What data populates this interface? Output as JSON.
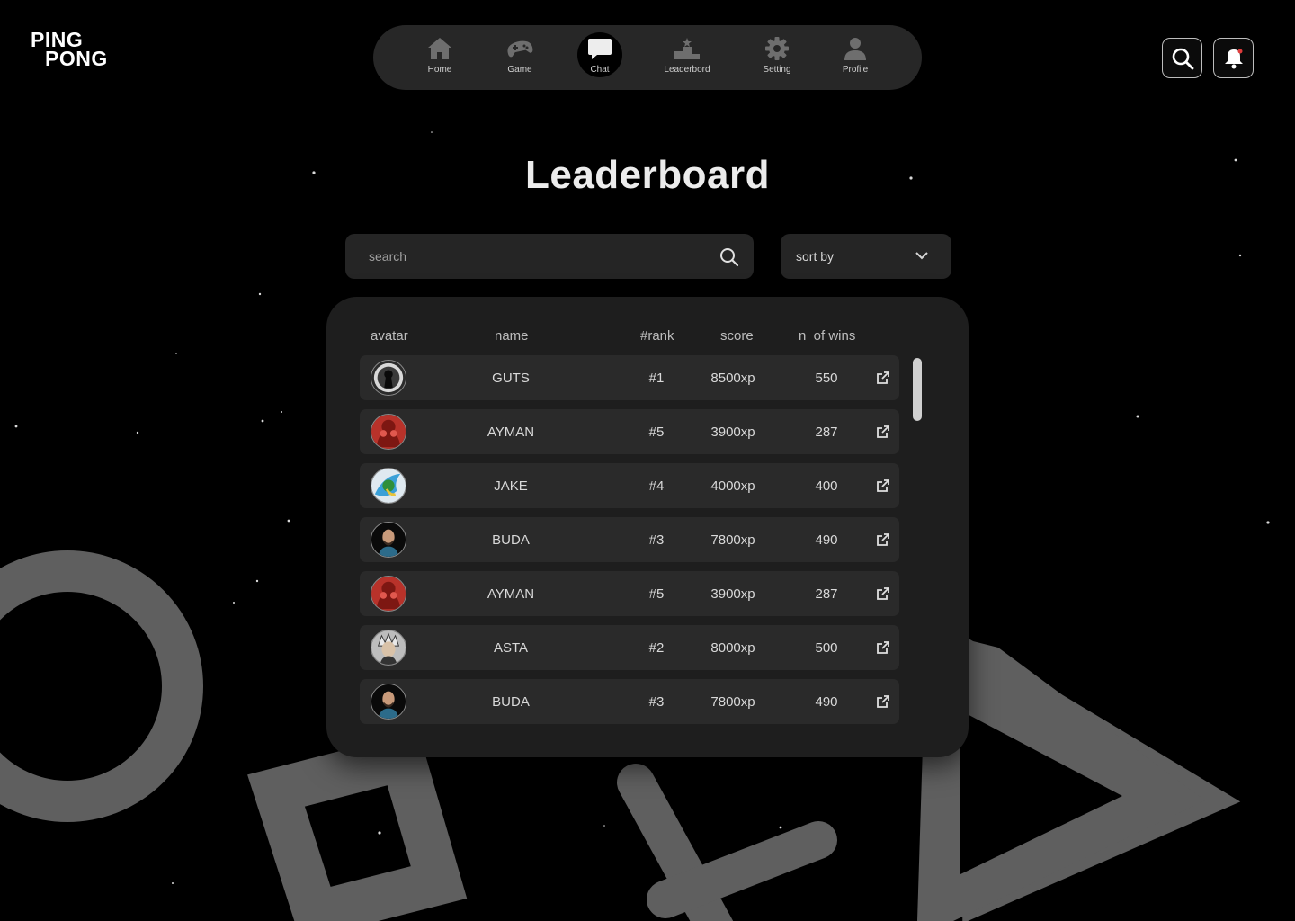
{
  "logo": {
    "line1": "PING",
    "line2": "PONG"
  },
  "nav": {
    "items": [
      {
        "label": "Home",
        "icon": "home-icon"
      },
      {
        "label": "Game",
        "icon": "gamepad-icon"
      },
      {
        "label": "Chat",
        "icon": "chat-icon",
        "active": true
      },
      {
        "label": "Leaderbord",
        "icon": "podium-icon"
      },
      {
        "label": "Setting",
        "icon": "gear-icon"
      },
      {
        "label": "Profile",
        "icon": "user-icon"
      }
    ]
  },
  "header": {
    "search_icon": "search-icon",
    "notification_icon": "bell-icon"
  },
  "page": {
    "title": "Leaderboard"
  },
  "controls": {
    "search_placeholder": "search",
    "sort_label": "sort by"
  },
  "table": {
    "headers": {
      "avatar": "avatar",
      "name": "name",
      "rank": "#rank",
      "score": "score",
      "wins": "n  of wins"
    },
    "rows": [
      {
        "name": "GUTS",
        "rank": "#1",
        "score": "8500xp",
        "wins": "550",
        "avatar": "keyhole"
      },
      {
        "name": "AYMAN",
        "rank": "#5",
        "score": "3900xp",
        "wins": "287",
        "avatar": "red"
      },
      {
        "name": "JAKE",
        "rank": "#4",
        "score": "4000xp",
        "wins": "400",
        "avatar": "bird"
      },
      {
        "name": "BUDA",
        "rank": "#3",
        "score": "7800xp",
        "wins": "490",
        "avatar": "man"
      },
      {
        "name": "AYMAN",
        "rank": "#5",
        "score": "3900xp",
        "wins": "287",
        "avatar": "red"
      },
      {
        "name": "ASTA",
        "rank": "#2",
        "score": "8000xp",
        "wins": "500",
        "avatar": "anime"
      },
      {
        "name": "BUDA",
        "rank": "#3",
        "score": "7800xp",
        "wins": "490",
        "avatar": "man"
      }
    ]
  },
  "colors": {
    "background": "#000000",
    "panel": "#1e1e1e",
    "row": "#2a2a2a",
    "shapes": "#5f5f5f"
  }
}
